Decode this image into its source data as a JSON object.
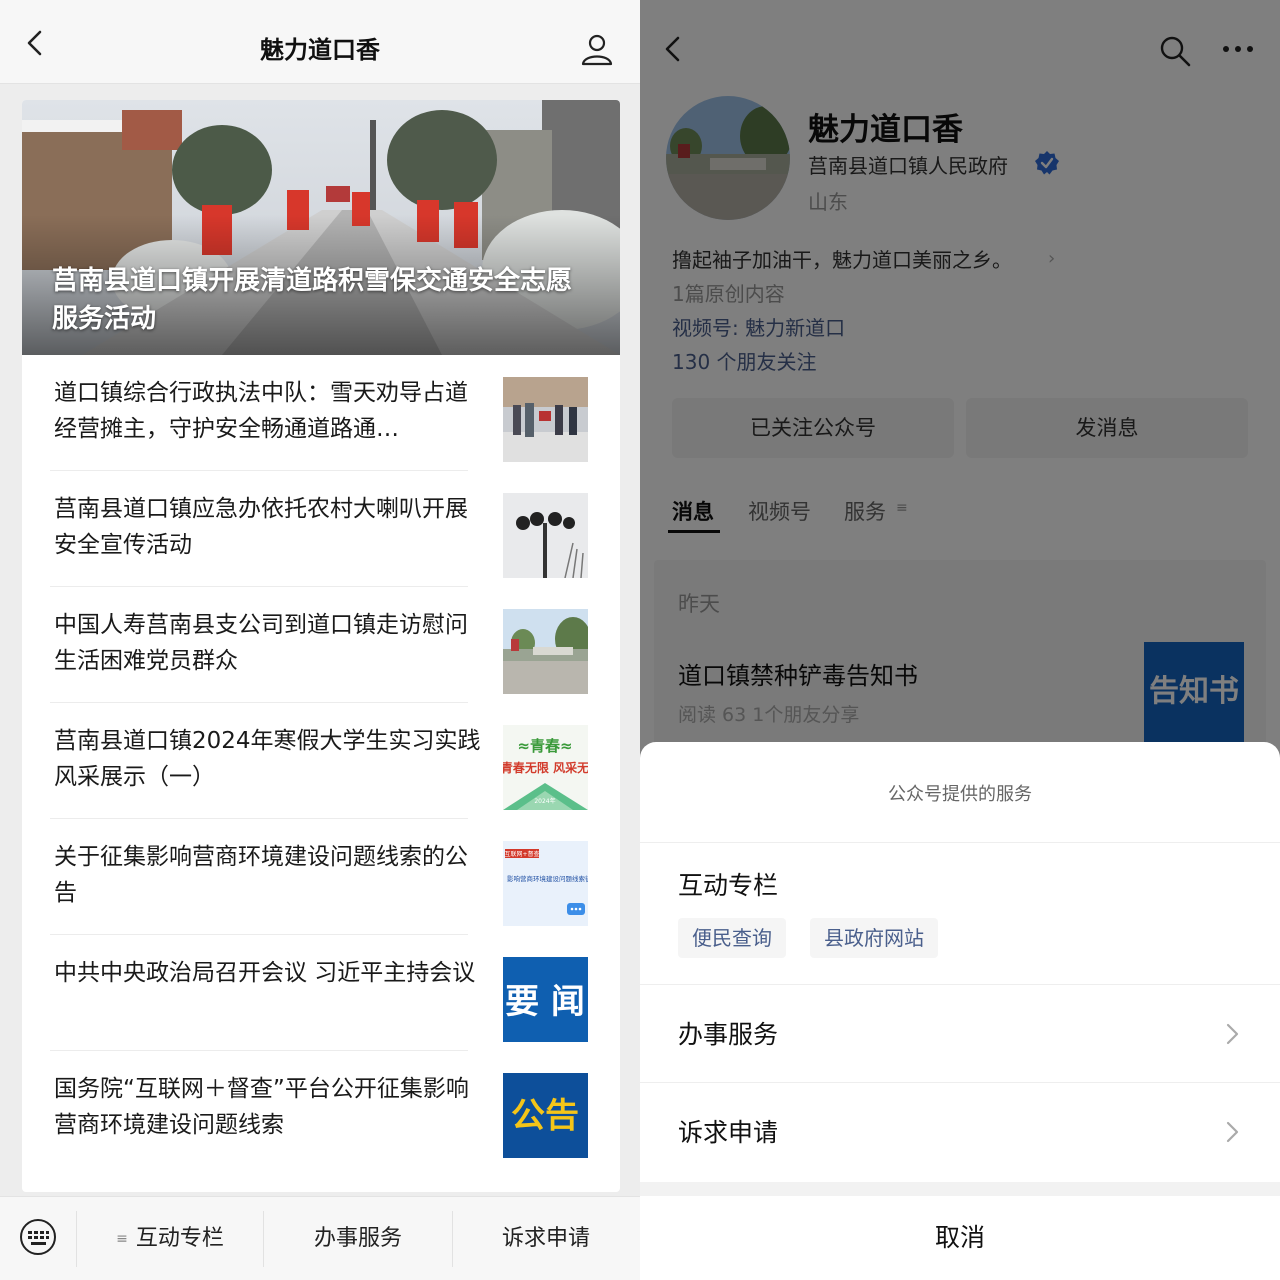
{
  "left": {
    "title": "魅力道口香",
    "hero_title": "莒南县道口镇开展清道路积雪保交通安全志愿服务活动",
    "articles": [
      {
        "title": "道口镇综合行政执法中队：雪天劝导占道经营摊主，守护安全畅通道路通…",
        "thumb": "street-people-photo"
      },
      {
        "title": "莒南县道口镇应急办依托农村大喇叭开展安全宣传活动",
        "thumb": "loudspeaker-photo"
      },
      {
        "title": "中国人寿莒南县支公司到道口镇走访慰问生活困难党员群众",
        "thumb": "village-gate-photo"
      },
      {
        "title": "莒南县道口镇2024年寒假大学生实习实践风采展示（一）",
        "thumb": "green-poster",
        "thumb_text1": "青春无限 风采无",
        "thumb_text2": "2024年"
      },
      {
        "title": "关于征集影响营商环境建设问题线索的公告",
        "thumb": "blue-notice",
        "thumb_text1": "互联网+督查",
        "thumb_text2": "影响营商环境建设问题线索征集"
      },
      {
        "title": "中共中央政治局召开会议 习近平主持会议",
        "thumb": "news-tile",
        "thumb_text1": "要 闻"
      },
      {
        "title": "国务院“互联网＋督查”平台公开征集影响营商环境建设问题线索",
        "thumb": "notice-tile",
        "thumb_text1": "公告"
      }
    ],
    "bottom_menu": [
      "互动专栏",
      "办事服务",
      "诉求申请"
    ],
    "menu_hamburger": "≡"
  },
  "right": {
    "account_name": "魅力道口香",
    "org": "莒南县道口镇人民政府",
    "location": "山东",
    "bio": "撸起袖子加油干，魅力道口美丽之乡。",
    "bio_arrow": "›",
    "original_count": "1篇原创内容",
    "channel": "视频号: 魅力新道口",
    "friends": "130 个朋友关注",
    "buttons": [
      "已关注公众号",
      "发消息"
    ],
    "tabs": [
      "消息",
      "视频号",
      "服务"
    ],
    "tab_hamburger": "≡",
    "feed": {
      "date": "昨天",
      "title": "道口镇禁种铲毒告知书",
      "meta": "阅读 63   1个朋友分享",
      "thumb_text": "告知书"
    },
    "sheet": {
      "title": "公众号提供的服务",
      "section": "互动专栏",
      "chips": [
        "便民查询",
        "县政府网站"
      ],
      "rows": [
        "办事服务",
        "诉求申请"
      ],
      "cancel": "取消"
    }
  },
  "colors": {
    "link": "#4a5f8c",
    "verified": "#2e6bd6",
    "dim_overlay": "rgba(0,0,0,0.5)",
    "news_tile": "#1565c0"
  }
}
